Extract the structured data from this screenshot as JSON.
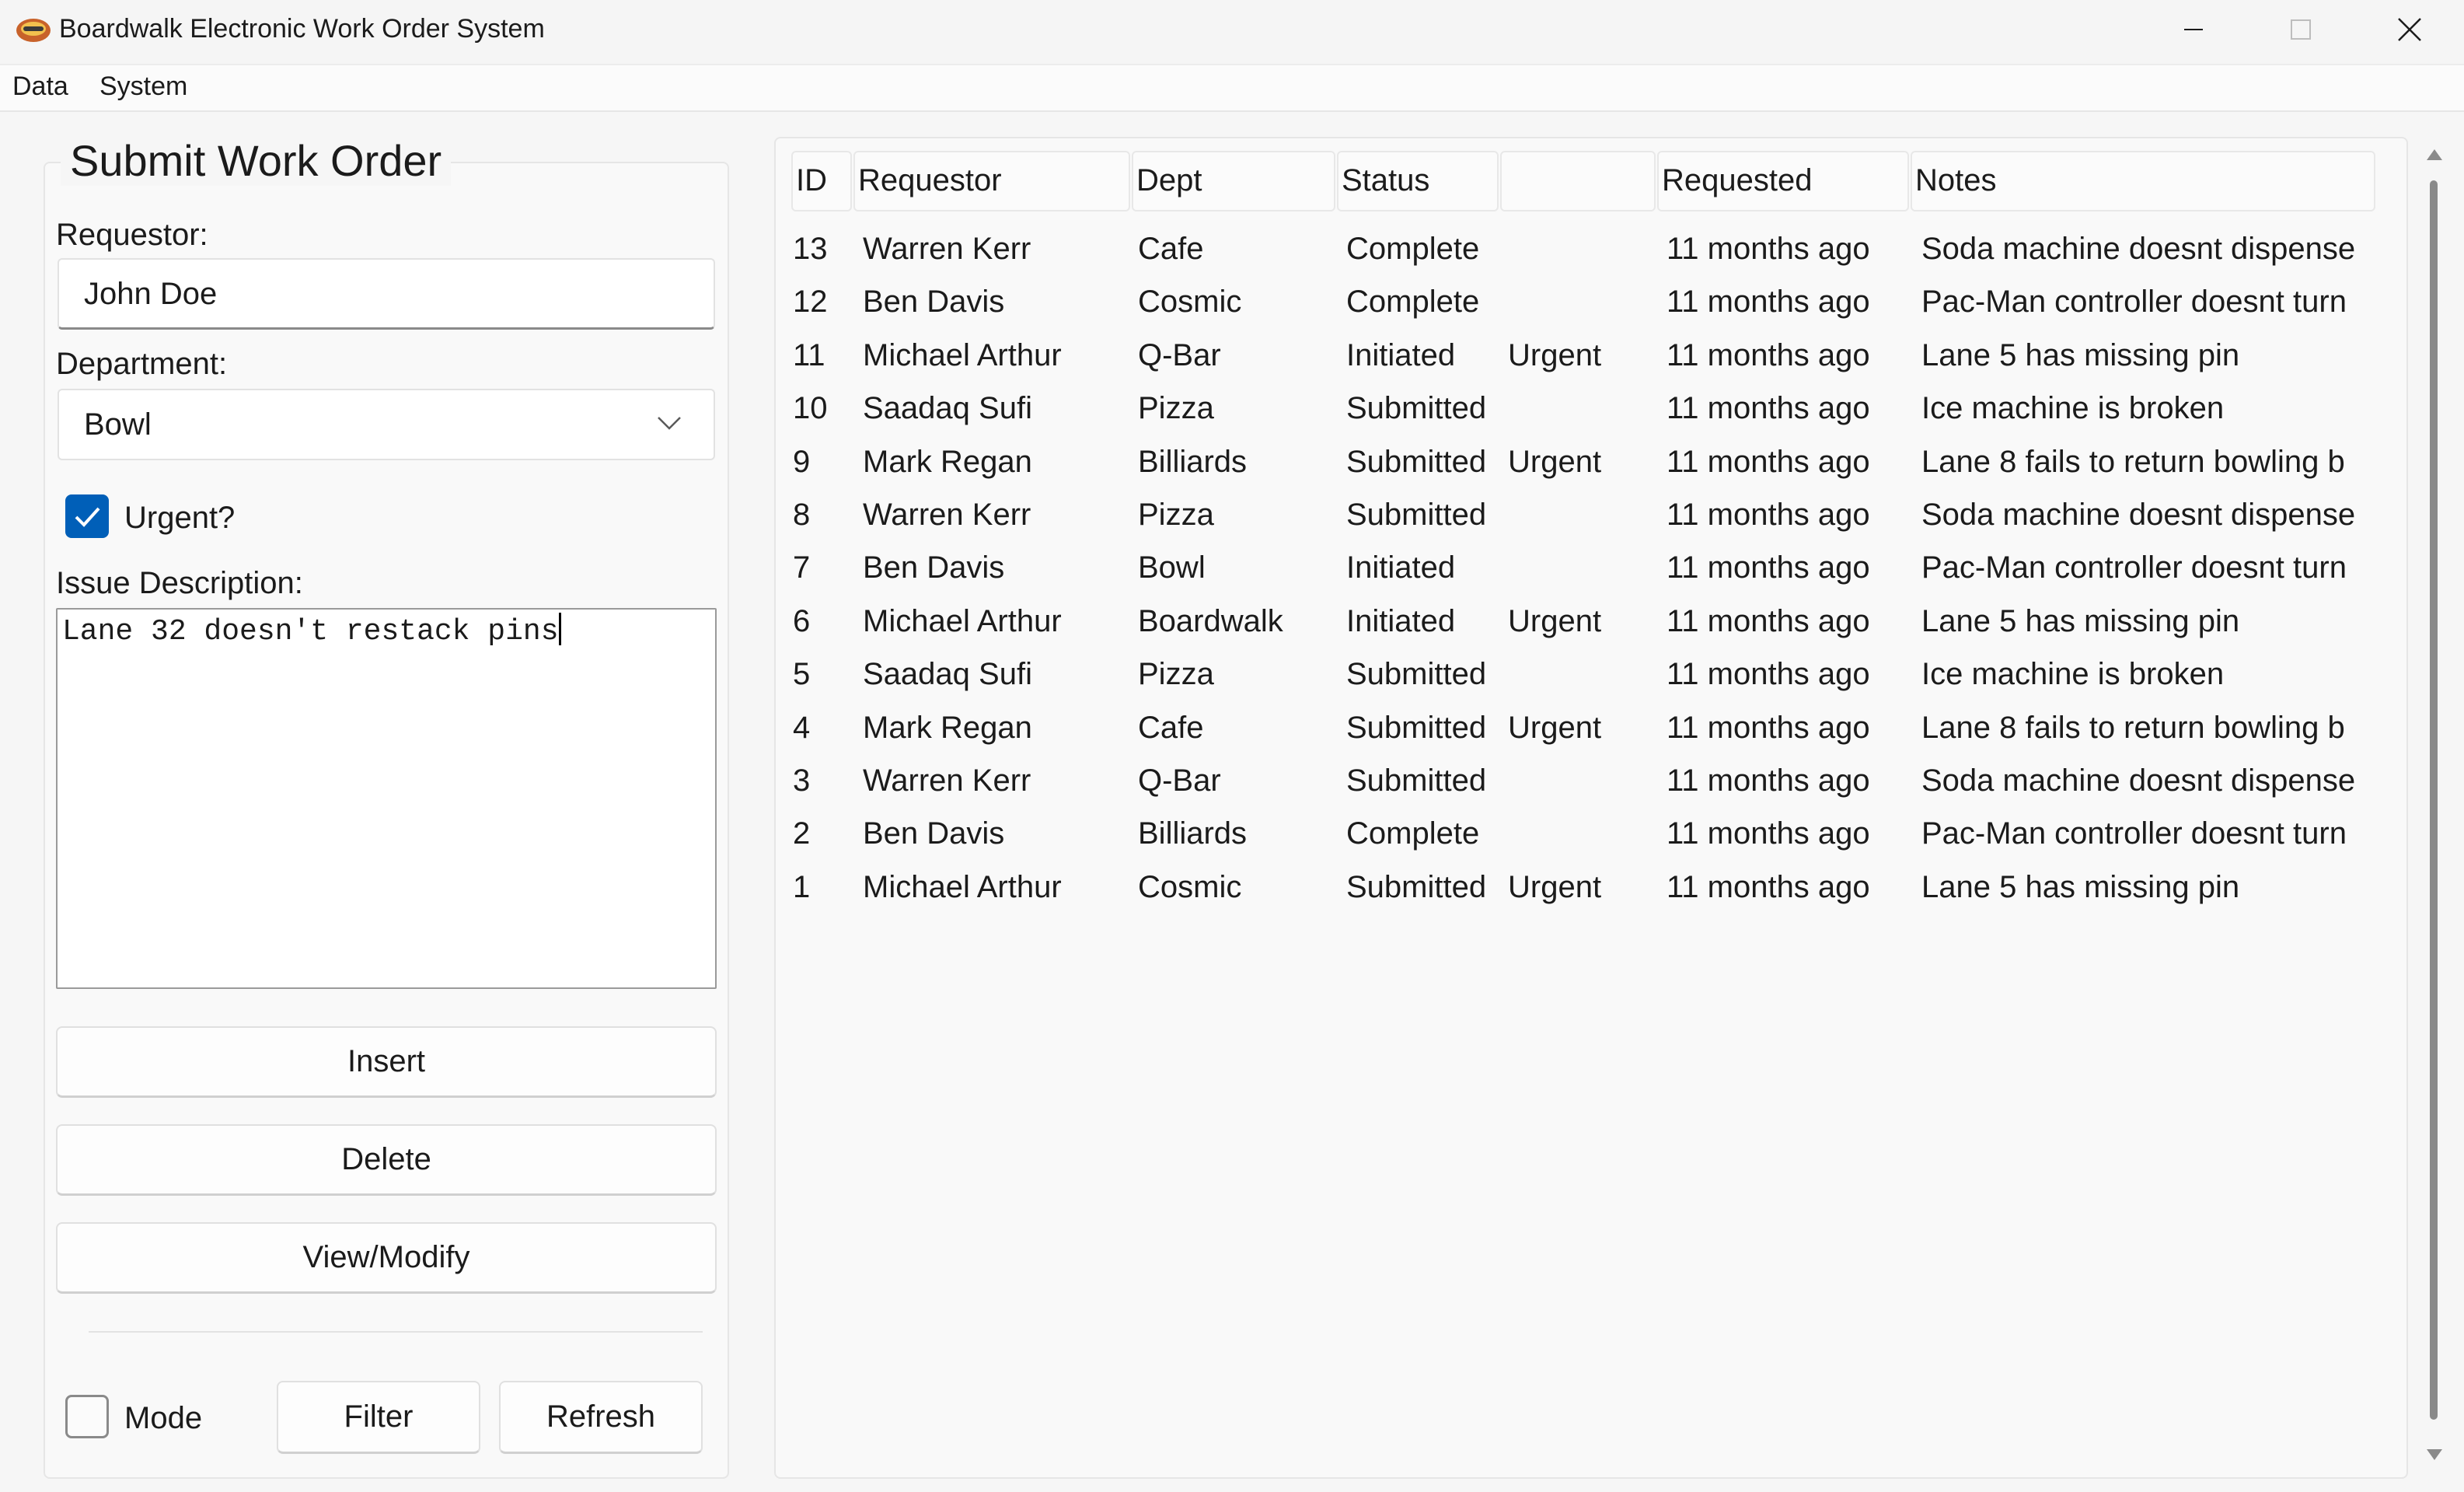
{
  "window": {
    "title": "Boardwalk Electronic Work Order System"
  },
  "menu": {
    "items": [
      "Data",
      "System"
    ]
  },
  "form": {
    "title": "Submit Work Order",
    "requestor_label": "Requestor:",
    "requestor_value": "John Doe",
    "department_label": "Department:",
    "department_value": "Bowl",
    "urgent_label": "Urgent?",
    "urgent_checked": true,
    "issue_label": "Issue Description:",
    "issue_value": "Lane 32 doesn't restack pins",
    "insert_label": "Insert",
    "delete_label": "Delete",
    "view_modify_label": "View/Modify",
    "mode_label": "Mode",
    "mode_checked": false,
    "filter_label": "Filter",
    "refresh_label": "Refresh"
  },
  "table": {
    "columns": [
      "ID",
      "Requestor",
      "Dept",
      "Status",
      "",
      "Requested",
      "Notes"
    ],
    "rows": [
      [
        "13",
        "Warren Kerr",
        "Cafe",
        "Complete",
        "",
        "11 months ago",
        "Soda machine doesnt dispense"
      ],
      [
        "12",
        "Ben Davis",
        "Cosmic",
        "Complete",
        "",
        "11 months ago",
        "Pac-Man controller doesnt turn"
      ],
      [
        "11",
        "Michael Arthur",
        "Q-Bar",
        "Initiated",
        "Urgent",
        "11 months ago",
        "Lane 5 has missing pin"
      ],
      [
        "10",
        "Saadaq Sufi",
        "Pizza",
        "Submitted",
        "",
        "11 months ago",
        "Ice machine is broken"
      ],
      [
        "9",
        "Mark Regan",
        "Billiards",
        "Submitted",
        "Urgent",
        "11 months ago",
        "Lane 8 fails to return bowling b"
      ],
      [
        "8",
        "Warren Kerr",
        "Pizza",
        "Submitted",
        "",
        "11 months ago",
        "Soda machine doesnt dispense"
      ],
      [
        "7",
        "Ben Davis",
        "Bowl",
        "Initiated",
        "",
        "11 months ago",
        "Pac-Man controller doesnt turn"
      ],
      [
        "6",
        "Michael Arthur",
        "Boardwalk",
        "Initiated",
        "Urgent",
        "11 months ago",
        "Lane 5 has missing pin"
      ],
      [
        "5",
        "Saadaq Sufi",
        "Pizza",
        "Submitted",
        "",
        "11 months ago",
        "Ice machine is broken"
      ],
      [
        "4",
        "Mark Regan",
        "Cafe",
        "Submitted",
        "Urgent",
        "11 months ago",
        "Lane 8 fails to return bowling b"
      ],
      [
        "3",
        "Warren Kerr",
        "Q-Bar",
        "Submitted",
        "",
        "11 months ago",
        "Soda machine doesnt dispense"
      ],
      [
        "2",
        "Ben Davis",
        "Billiards",
        "Complete",
        "",
        "11 months ago",
        "Pac-Man controller doesnt turn"
      ],
      [
        "1",
        "Michael Arthur",
        "Cosmic",
        "Submitted",
        "Urgent",
        "11 months ago",
        "Lane 5 has missing pin"
      ]
    ]
  },
  "colors": {
    "accent": "#005fb8",
    "window_bg": "#f6f6f6"
  },
  "icons": {
    "app": "boardwalk-logo-icon",
    "minimize": "minimize-icon",
    "maximize": "maximize-icon",
    "close": "close-icon",
    "dropdown": "chevron-down-icon",
    "check": "checkmark-icon"
  }
}
